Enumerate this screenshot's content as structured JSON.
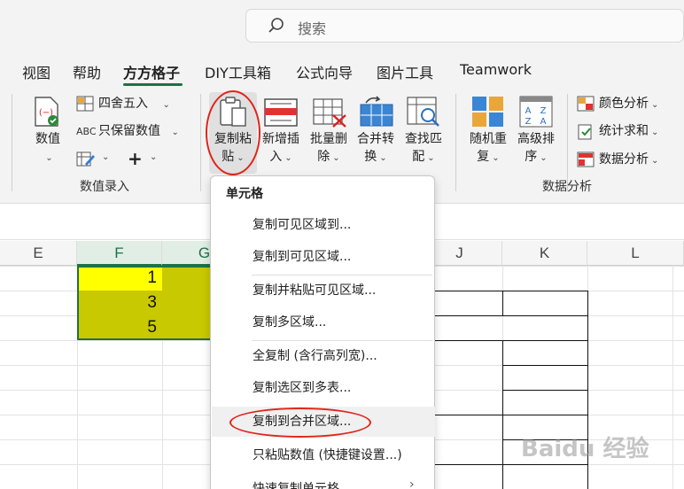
{
  "search": {
    "placeholder": "搜索",
    "icon": "search-icon"
  },
  "tabs": [
    {
      "label": "视图"
    },
    {
      "label": "帮助"
    },
    {
      "label": "方方格子",
      "active": true
    },
    {
      "label": "DIY工具箱"
    },
    {
      "label": "公式向导"
    },
    {
      "label": "图片工具"
    },
    {
      "label": "Teamwork"
    }
  ],
  "ribbon": {
    "numeric": {
      "label": "数值",
      "icon": "number-icon"
    },
    "round": {
      "label": "四舍五入",
      "icon": "round-icon"
    },
    "keep_value": {
      "label": "只保留数值",
      "icon": "abc-icon"
    },
    "edit_icon": "edit-icon",
    "plus": "+",
    "group1_label": "数值录入",
    "copy_paste": {
      "line1": "复制粘",
      "line2": "贴",
      "icon": "clipboard-icon"
    },
    "insert": {
      "line1": "新增插",
      "line2": "入",
      "icon": "insert-icon"
    },
    "batch_delete": {
      "line1": "批量删",
      "line2": "除",
      "icon": "delete-grid-icon"
    },
    "merge_convert": {
      "line1": "合并转",
      "line2": "换",
      "icon": "merge-icon"
    },
    "find_match": {
      "line1": "查找匹",
      "line2": "配",
      "icon": "find-icon"
    },
    "random_repeat": {
      "line1": "随机重",
      "line2": "复",
      "icon": "random-icon"
    },
    "advanced_sort": {
      "line1": "高级排",
      "line2": "序",
      "icon": "sort-icon"
    },
    "color_analysis": {
      "label": "颜色分析",
      "icon": "color-grid-icon"
    },
    "stat_sum": {
      "label": "统计求和",
      "icon": "sum-icon"
    },
    "data_analysis": {
      "label": "数据分析",
      "icon": "data-grid-icon"
    },
    "group3_label": "数据分析"
  },
  "sheet": {
    "columns": [
      "E",
      "F",
      "G",
      "J",
      "K",
      "L"
    ],
    "values": [
      "1",
      "3",
      "5"
    ]
  },
  "menu": {
    "header": "单元格",
    "items": [
      "复制可见区域到...",
      "复制到可见区域...",
      "复制并粘贴可见区域...",
      "复制多区域...",
      "全复制 (含行高列宽)...",
      "复制选区到多表...",
      "复制到合并区域...",
      "只粘贴数值 (快捷键设置...)",
      "快速复制单元格"
    ]
  },
  "watermark": "Baidu 经验",
  "colors": {
    "accent": "#1e7145",
    "highlight_red": "#e0251b",
    "yellow": "#ffff00",
    "olive": "#c9c900"
  }
}
